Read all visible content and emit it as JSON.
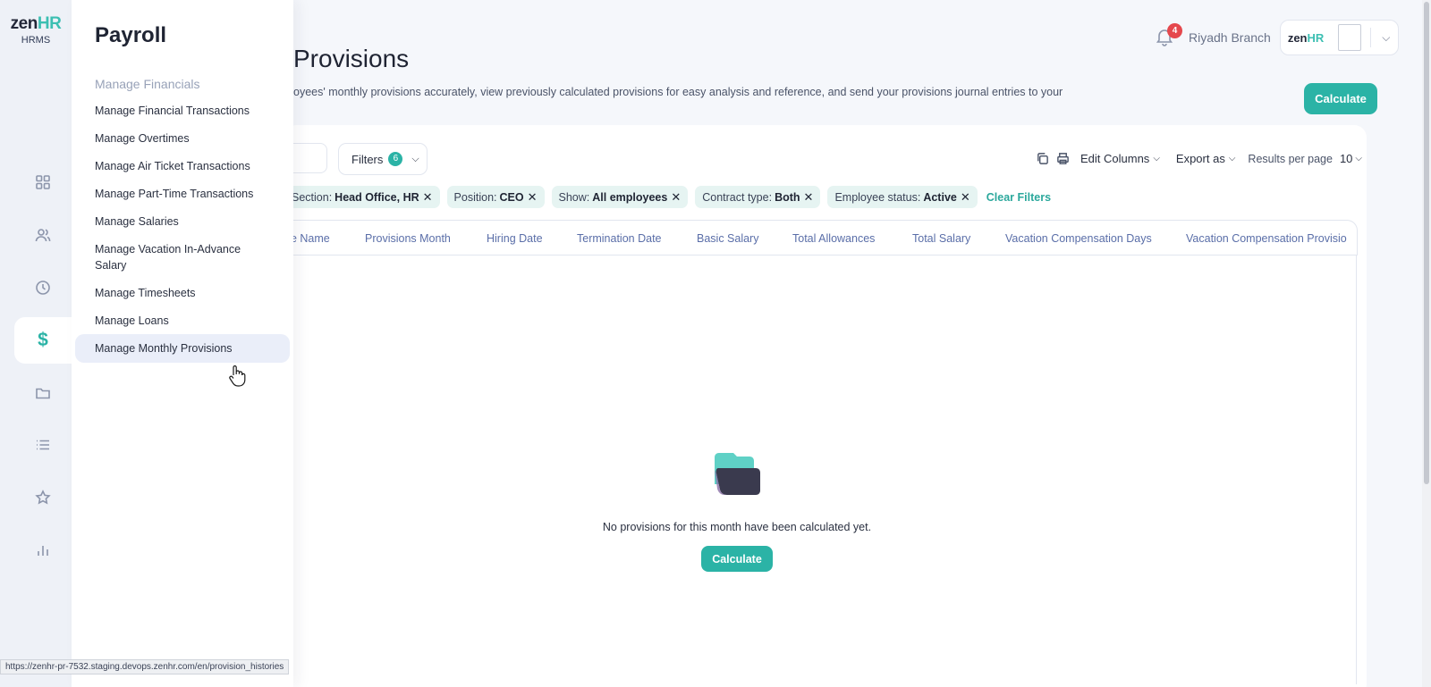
{
  "app": {
    "logo_text": "zen",
    "logo_hr": "HR",
    "product": "HRMS"
  },
  "rail": {
    "items": [
      {
        "icon": "dashboard-icon"
      },
      {
        "icon": "people-icon"
      },
      {
        "icon": "clock-icon"
      },
      {
        "icon": "dollar-icon",
        "glyph": "$",
        "active": true
      },
      {
        "icon": "folder-icon"
      },
      {
        "icon": "list-icon"
      },
      {
        "icon": "star-icon"
      },
      {
        "icon": "bar-chart-icon"
      }
    ]
  },
  "flyout": {
    "title": "Payroll",
    "section": "Manage Financials",
    "items": [
      "Manage Financial Transactions",
      "Manage Overtimes",
      "Manage Air Ticket Transactions",
      "Manage Part-Time Transactions",
      "Manage Salaries",
      "Manage Vacation In-Advance Salary",
      "Manage Timesheets",
      "Manage Loans",
      "Manage Monthly Provisions"
    ],
    "active_index": 8
  },
  "header": {
    "notification_count": "4",
    "branch": "Riyadh Branch",
    "mini_logo_text": "zen",
    "mini_logo_hr": "HR",
    "chevron": "⌵"
  },
  "page": {
    "title": "Provisions",
    "description": "oyees' monthly provisions accurately, view previously calculated provisions for easy analysis and reference, and send your provisions journal entries to your",
    "calculate_label": "Calculate"
  },
  "toolbar": {
    "filters_label": "Filters",
    "filters_count": "6",
    "edit_columns": "Edit Columns",
    "export_as": "Export as",
    "results_per_page": "Results per page",
    "results_value": "10"
  },
  "chips": [
    {
      "key": "Section:",
      "value": "Head Office, HR"
    },
    {
      "key": "Position:",
      "value": "CEO"
    },
    {
      "key": "Show:",
      "value": "All employees"
    },
    {
      "key": "Contract type:",
      "value": "Both"
    },
    {
      "key": "Employee status:",
      "value": "Active"
    }
  ],
  "clear_filters": "Clear Filters",
  "table": {
    "columns": [
      "ee Name",
      "Provisions Month",
      "Hiring Date",
      "Termination Date",
      "Basic Salary",
      "Total Allowances",
      "Total Salary",
      "Vacation Compensation Days",
      "Vacation Compensation Provisio"
    ]
  },
  "empty_state": {
    "message": "No provisions for this month have been calculated yet.",
    "button": "Calculate"
  },
  "status_url": "https://zenhr-pr-7532.staging.devops.zenhr.com/en/provision_histories",
  "colors": {
    "accent": "#2bb3a6",
    "badge": "#e5484d",
    "active_bg": "#eaeef9"
  }
}
